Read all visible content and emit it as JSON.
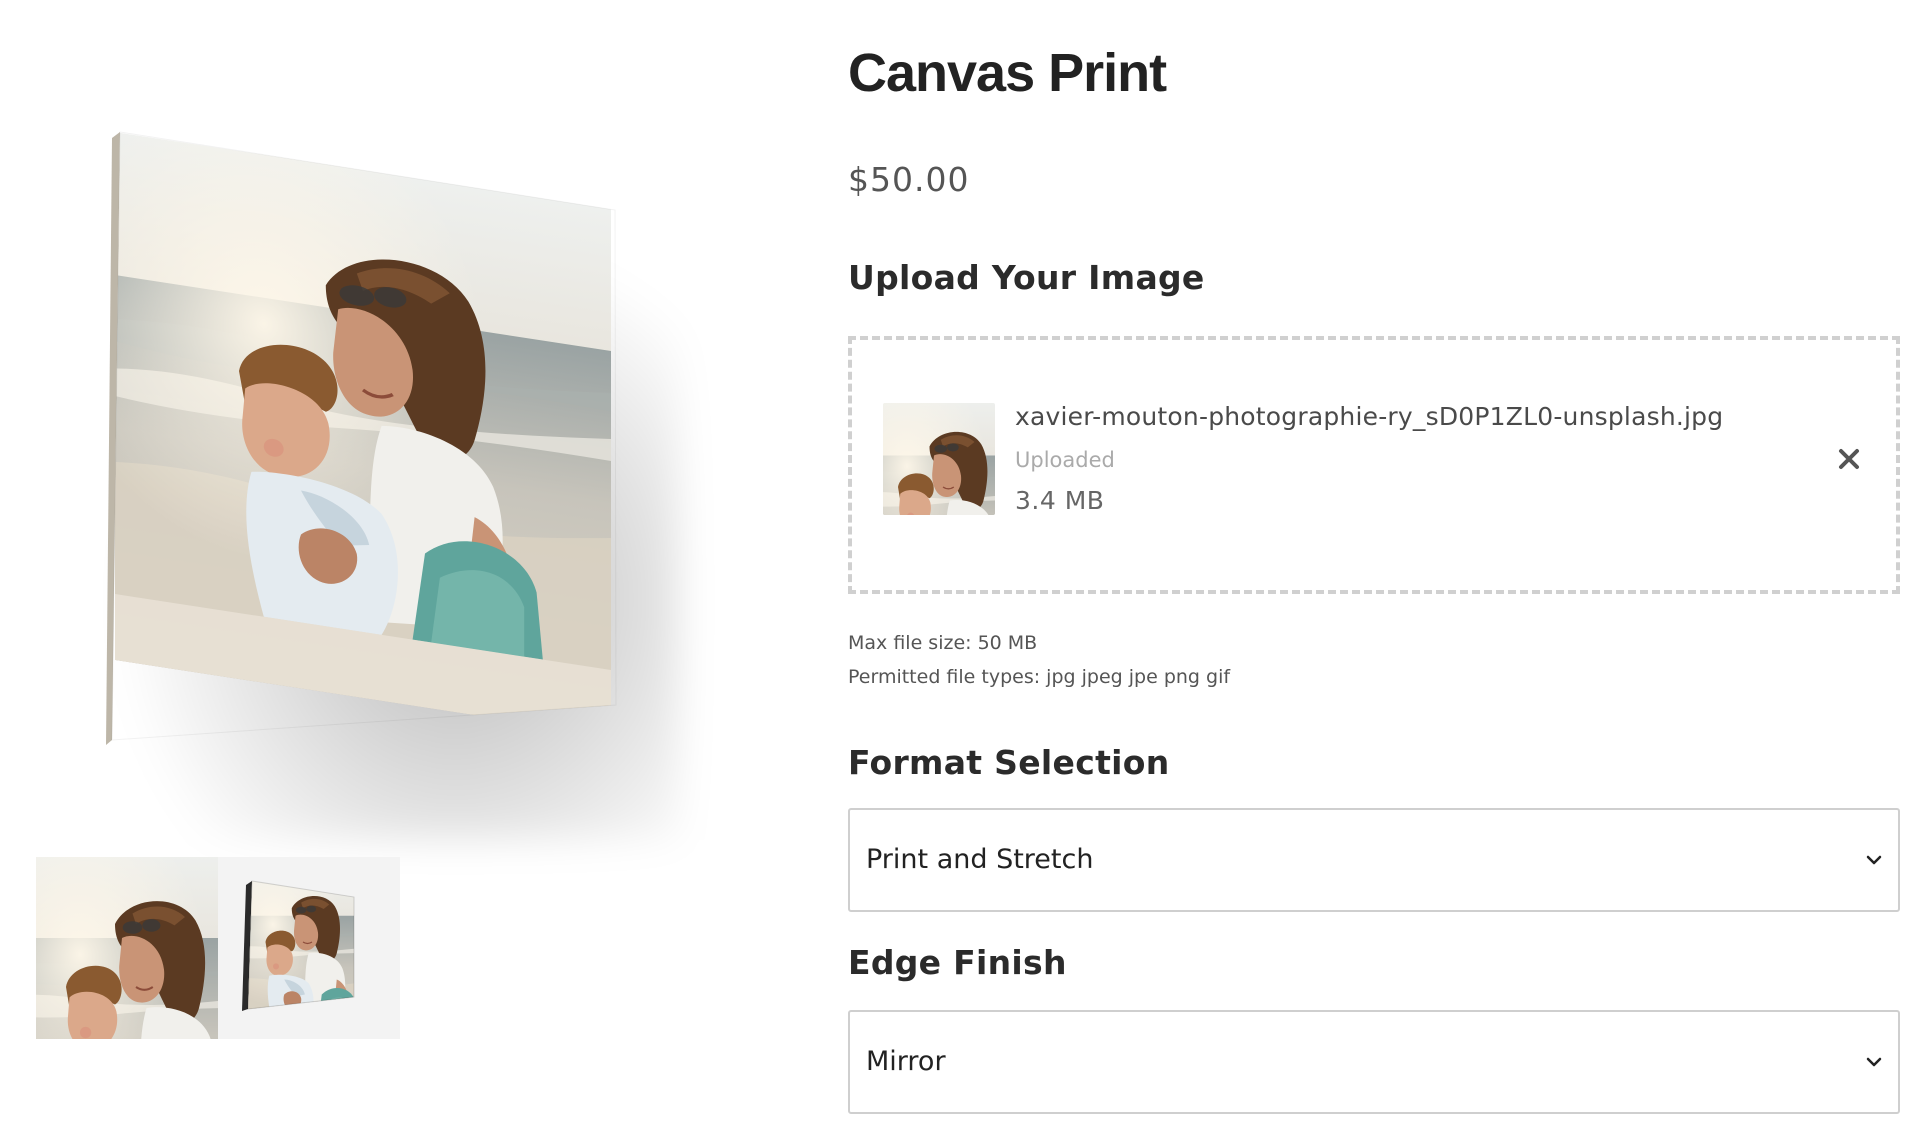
{
  "product": {
    "title": "Canvas Print",
    "price": "$50.00"
  },
  "gallery": {
    "main_image": "canvas-print-mother-child-beach",
    "thumbnails": [
      "photo-thumbnail",
      "canvas-mockup-thumbnail"
    ]
  },
  "upload": {
    "heading": "Upload Your Image",
    "file": {
      "name": "xavier-mouton-photographie-ry_sD0P1ZL0-unsplash.jpg",
      "status": "Uploaded",
      "size": "3.4 MB"
    },
    "remove_icon": "close-icon",
    "max_size": "Max file size: 50 MB",
    "permitted_types": "Permitted file types: jpg jpeg jpe png gif"
  },
  "format": {
    "heading": "Format Selection",
    "selected": "Print and Stretch"
  },
  "edge": {
    "heading": "Edge Finish",
    "selected": "Mirror"
  },
  "colors": {
    "text": "#2b2b2b",
    "muted": "#aaaaaa",
    "border": "#cfcfcf",
    "dashed_border": "#d0d0d0"
  }
}
